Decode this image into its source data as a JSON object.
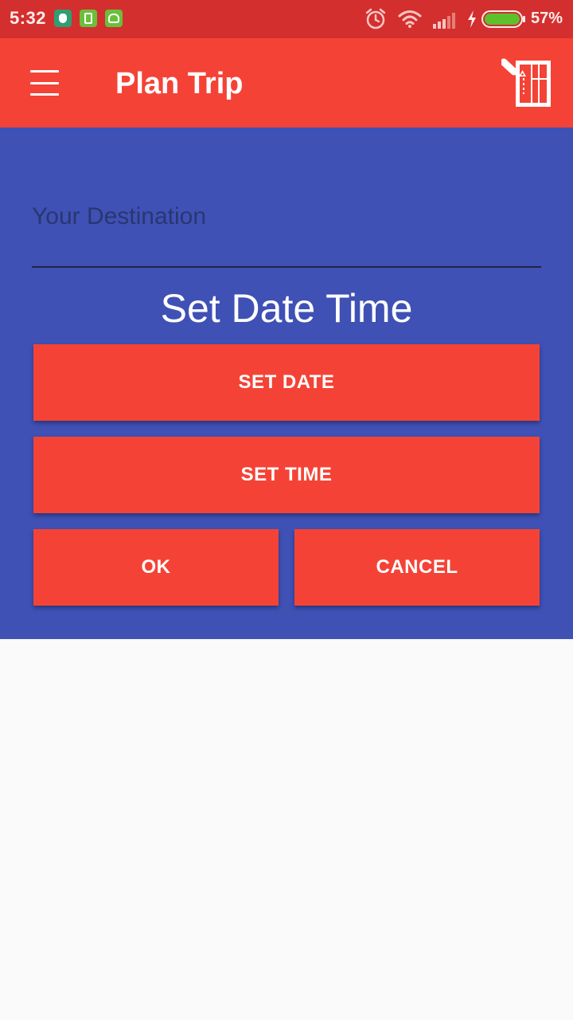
{
  "status_bar": {
    "time": "5:32",
    "battery_percent": "57%",
    "battery_level": 0.57,
    "notification_icons": [
      "security-icon",
      "sim-icon",
      "android-icon"
    ],
    "system_icons": [
      "alarm-icon",
      "wifi-icon",
      "signal-icon",
      "charging-icon",
      "battery-icon"
    ]
  },
  "app_bar": {
    "title": "Plan Trip",
    "menu_icon": "hamburger-menu-icon",
    "action_icon": "map-icon"
  },
  "form": {
    "destination_placeholder": "Your Destination",
    "destination_value": "",
    "heading": "Set Date Time",
    "set_date_label": "SET DATE",
    "set_time_label": "SET TIME",
    "ok_label": "OK",
    "cancel_label": "CANCEL"
  },
  "colors": {
    "status_bar": "#D32F2F",
    "app_bar": "#F44336",
    "panel": "#3F51B5",
    "button": "#F44336",
    "background": "#FAFAFA"
  }
}
